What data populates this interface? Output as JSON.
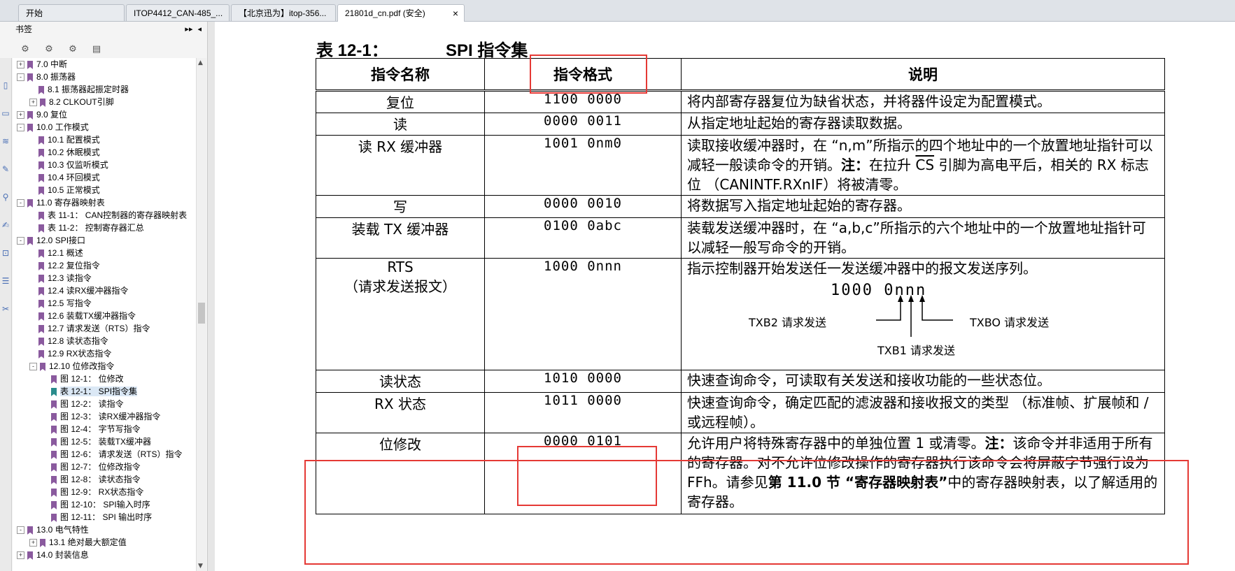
{
  "tabs": [
    {
      "label": "开始"
    },
    {
      "label": "ITOP4412_CAN-485_..."
    },
    {
      "label": "【北京迅为】itop-356..."
    },
    {
      "label": "21801d_cn.pdf (安全)",
      "active": true
    }
  ],
  "sidebar": {
    "title": "书签",
    "items": [
      {
        "label": "7.0 中断",
        "level": 0,
        "exp": "+"
      },
      {
        "label": "8.0 振荡器",
        "level": 0,
        "exp": "-"
      },
      {
        "label": "8.1 振荡器起振定时器",
        "level": 1
      },
      {
        "label": "8.2 CLKOUT引脚",
        "level": 1,
        "exp": "+"
      },
      {
        "label": "9.0 复位",
        "level": 0,
        "exp": "+"
      },
      {
        "label": "10.0 工作模式",
        "level": 0,
        "exp": "-"
      },
      {
        "label": "10.1 配置模式",
        "level": 1
      },
      {
        "label": "10.2 休眠模式",
        "level": 1
      },
      {
        "label": "10.3 仅监听模式",
        "level": 1
      },
      {
        "label": "10.4 环回模式",
        "level": 1
      },
      {
        "label": "10.5 正常模式",
        "level": 1
      },
      {
        "label": "11.0 寄存器映射表",
        "level": 0,
        "exp": "-"
      },
      {
        "label": "表 11-1： CAN控制器的寄存器映射表",
        "level": 1
      },
      {
        "label": "表 11-2： 控制寄存器汇总",
        "level": 1
      },
      {
        "label": "12.0 SPI接口",
        "level": 0,
        "exp": "-"
      },
      {
        "label": "12.1 概述",
        "level": 1
      },
      {
        "label": "12.2 复位指令",
        "level": 1
      },
      {
        "label": "12.3 读指令",
        "level": 1
      },
      {
        "label": "12.4 读RX缓冲器指令",
        "level": 1
      },
      {
        "label": "12.5 写指令",
        "level": 1
      },
      {
        "label": "12.6 装载TX缓冲器指令",
        "level": 1
      },
      {
        "label": "12.7 请求发送（RTS）指令",
        "level": 1
      },
      {
        "label": "12.8 读状态指令",
        "level": 1
      },
      {
        "label": "12.9 RX状态指令",
        "level": 1
      },
      {
        "label": "12.10 位修改指令",
        "level": 1,
        "exp": "-"
      },
      {
        "label": "图 12-1： 位修改",
        "level": 2
      },
      {
        "label": "表 12-1： SPI指令集",
        "level": 2,
        "selected": true
      },
      {
        "label": "图 12-2： 读指令",
        "level": 2
      },
      {
        "label": "图 12-3： 读RX缓冲器指令",
        "level": 2
      },
      {
        "label": "图 12-4： 字节写指令",
        "level": 2
      },
      {
        "label": "图 12-5： 装载TX缓冲器",
        "level": 2
      },
      {
        "label": "图 12-6： 请求发送（RTS）指令",
        "level": 2
      },
      {
        "label": "图 12-7： 位修改指令",
        "level": 2
      },
      {
        "label": "图 12-8： 读状态指令",
        "level": 2
      },
      {
        "label": "图 12-9： RX状态指令",
        "level": 2
      },
      {
        "label": "图 12-10： SPI输入时序",
        "level": 2
      },
      {
        "label": "图 12-11： SPI 输出时序",
        "level": 2
      },
      {
        "label": "13.0 电气特性",
        "level": 0,
        "exp": "-"
      },
      {
        "label": "13.1 绝对最大额定值",
        "level": 1,
        "exp": "+"
      },
      {
        "label": "14.0 封装信息",
        "level": 0,
        "exp": "+"
      }
    ]
  },
  "document": {
    "table_label": "表 12-1：",
    "table_title": "SPI 指令集",
    "headers": [
      "指令名称",
      "指令格式",
      "说明"
    ],
    "rows": [
      {
        "name": "复位",
        "format": "1100 0000",
        "desc": "将内部寄存器复位为缺省状态，并将器件设定为配置模式。"
      },
      {
        "name": "读",
        "format": "0000 0011",
        "desc": "从指定地址起始的寄存器读取数据。"
      },
      {
        "name": "读 RX 缓冲器",
        "format": "1001 0nm0",
        "desc_a": "读取接收缓冲器时，在 “n,m”所指示的四个地址中的一个放置地址指针可以减轻一般读命令的开销。",
        "desc_note": "注：",
        "desc_b": "在拉升 ",
        "desc_cs": "CS",
        "desc_c": " 引脚为高电平后，相关的 RX 标志位 （CANINTF.RXnIF）将被清零。"
      },
      {
        "name": "写",
        "format": "0000 0010",
        "desc": "将数据写入指定地址起始的寄存器。"
      },
      {
        "name": "装载 TX 缓冲器",
        "format": "0100 0abc",
        "desc": "装载发送缓冲器时，在 “a,b,c”所指示的六个地址中的一个放置地址指针可以减轻一般写命令的开销。"
      },
      {
        "name": "RTS",
        "name2": "（请求发送报文）",
        "format": "1000 0nnn",
        "desc": "指示控制器开始发送任一发送缓冲器中的报文发送序列。",
        "diagram_code": "1000 0nnn",
        "txb2": "TXB2 请求发送",
        "txb1": "TXB1 请求发送",
        "txb0": "TXBO 请求发送"
      },
      {
        "name": "读状态",
        "format": "1010 0000",
        "desc": "快速查询命令，可读取有关发送和接收功能的一些状态位。"
      },
      {
        "name": "RX 状态",
        "format": "1011 0000",
        "desc": "快速查询命令，确定匹配的滤波器和接收报文的类型 （标准帧、扩展帧和 / 或远程帧）。"
      },
      {
        "name": "位修改",
        "format": "0000 0101",
        "desc_a": "允许用户将特殊寄存器中的单独位置 1 或清零。",
        "desc_note": "注：",
        "desc_b": "该命令并非适用于所有的寄存器。对不允许位修改操作的寄存器执行该命令会将屏蔽字节强行设为 FFh。请参见",
        "desc_ref": "第 11.0 节 “寄存器映射表”",
        "desc_c": "中的寄存器映射表，以了解适用的寄存器。"
      }
    ]
  },
  "colors": {
    "highlight": "#e53935",
    "bookmark": "#8a5a9e",
    "bookmark_selected": "#2a8c8c"
  }
}
